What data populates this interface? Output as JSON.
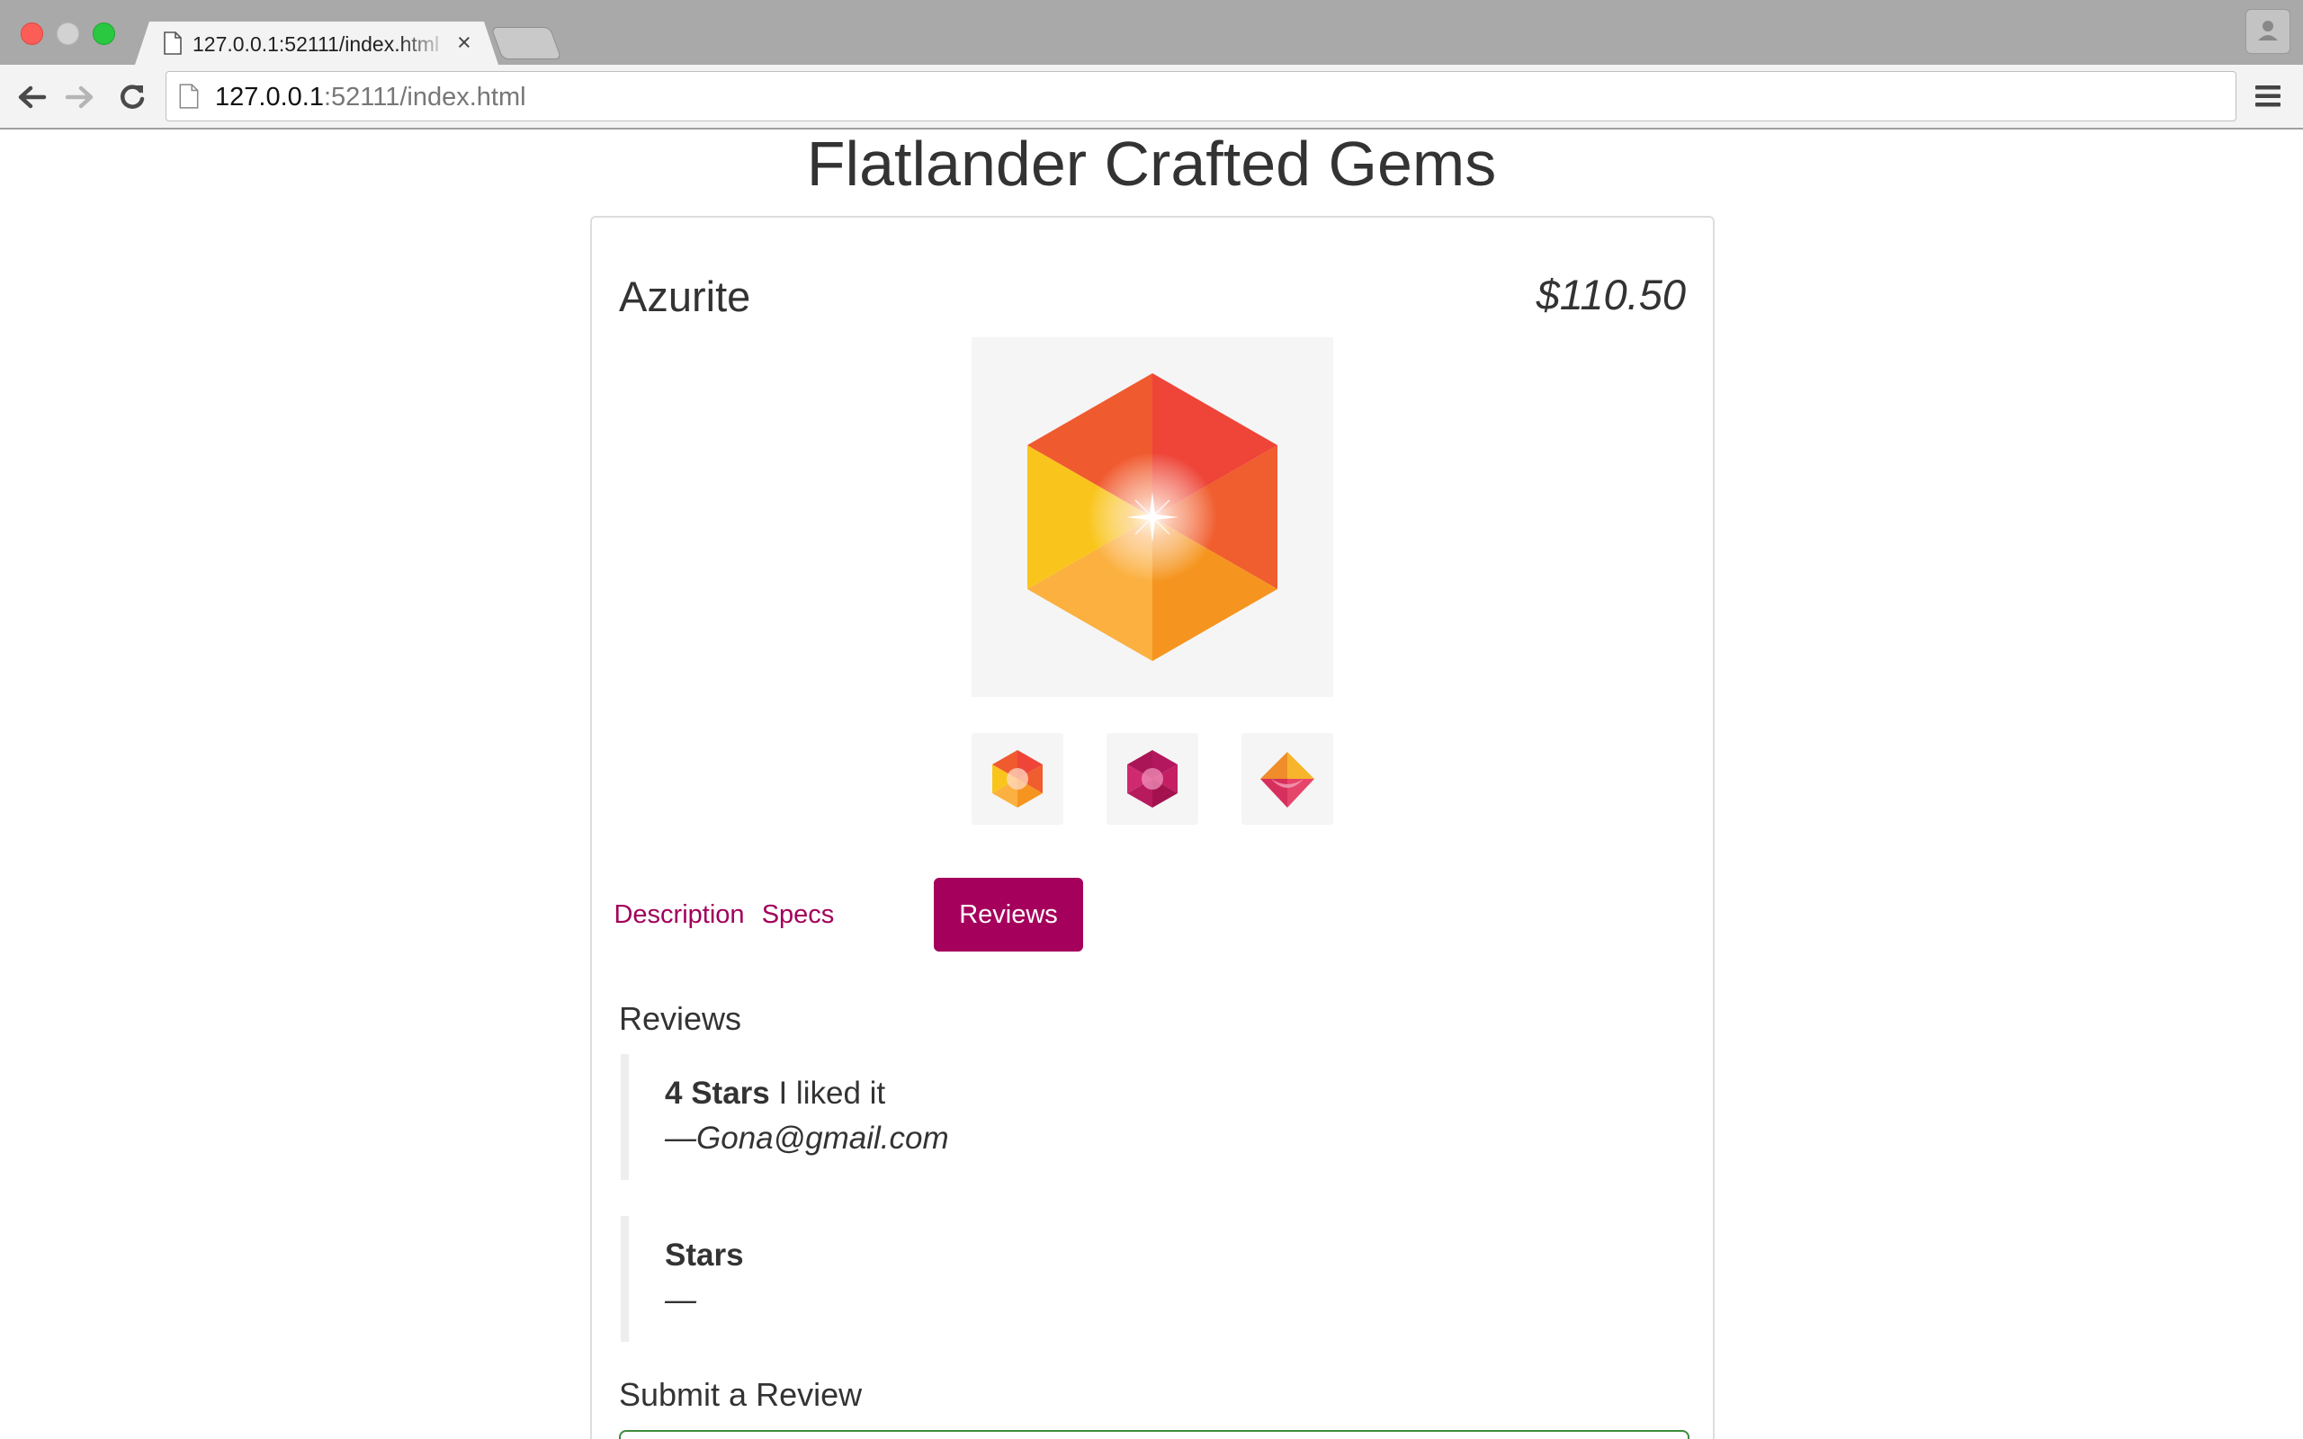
{
  "browser": {
    "tab_title": "127.0.0.1:52111/index.html",
    "tab_close": "×",
    "url_host": "127.0.0.1",
    "url_path": ":52111/index.html"
  },
  "page": {
    "title": "Flatlander Crafted Gems"
  },
  "product": {
    "name": "Azurite",
    "price": "$110.50",
    "images": [
      {
        "name": "orange-hexagon-gem",
        "colors": [
          "#ef5a3a",
          "#f7c11d",
          "#f79a2b"
        ]
      },
      {
        "name": "magenta-hexagon-gem",
        "colors": [
          "#b3175e",
          "#d0276e"
        ]
      },
      {
        "name": "diamond-gem",
        "colors": [
          "#f3a02d",
          "#d62f5e"
        ]
      }
    ]
  },
  "tabs": [
    {
      "label": "Description",
      "active": false
    },
    {
      "label": "Specs",
      "active": false
    },
    {
      "label": "Reviews",
      "active": true
    }
  ],
  "reviews_section": {
    "heading": "Reviews",
    "items": [
      {
        "stars": "4 Stars",
        "body": "I liked it",
        "author": "—Gona@gmail.com"
      },
      {
        "stars": "Stars",
        "body": "",
        "author": "—"
      }
    ]
  },
  "submit_section": {
    "heading": "Submit a Review"
  },
  "colors": {
    "accent": "#a5005c",
    "link": "#a1005a",
    "valid_field_border": "#3c8a3c"
  }
}
